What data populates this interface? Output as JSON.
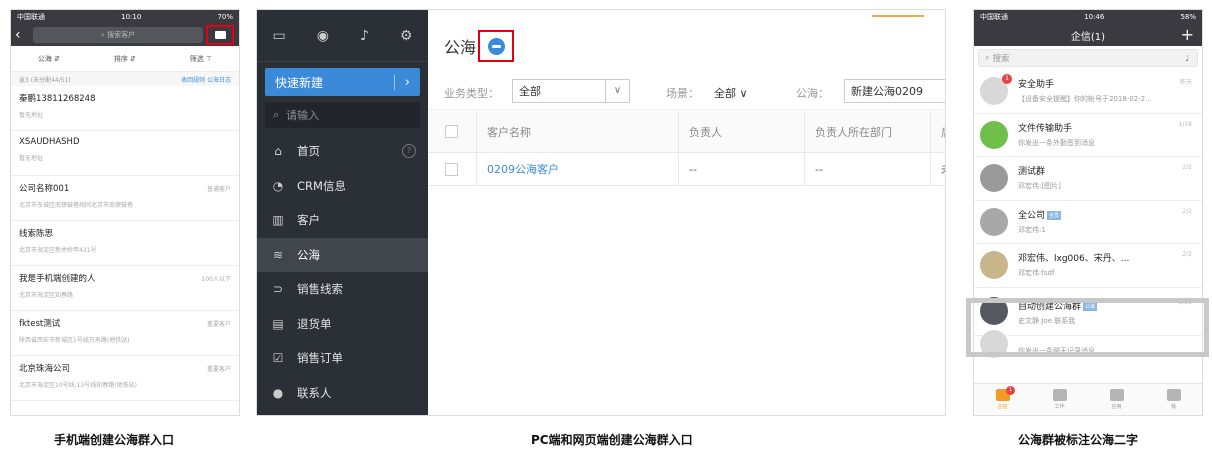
{
  "phone1": {
    "status": {
      "carrier": "中国联通",
      "time": "10:10",
      "battery": "70%"
    },
    "search_placeholder": "搜索客户",
    "filters": [
      "公海 ⇵",
      "排序 ⇵",
      "筛选 ⊤"
    ],
    "summary": "返3 (未分配44/51)",
    "summary_links": "收回规则  公海日志",
    "rows": [
      {
        "name": "秦鹏13811268248",
        "sub": "暂无地址",
        "tag": ""
      },
      {
        "name": "XSAUDHASHD",
        "sub": "暂无地址",
        "tag": ""
      },
      {
        "name": "公司名称001",
        "sub": "北京市东城区南锣鼓巷胡同北京市南锣鼓巷",
        "tag": "普通客户"
      },
      {
        "name": "线索陈思",
        "sub": "北京市海淀区新虎桥甲421号",
        "tag": ""
      },
      {
        "name": "我是手机端创建的人",
        "sub": "北京市海淀区知春路",
        "tag": "100人以下"
      },
      {
        "name": "fktest测试",
        "sub": "陕西省西安市新城区1号线万寿路(地铁站)",
        "tag": "重要客户"
      },
      {
        "name": "北京珠海公司",
        "sub": "北京市海淀区10号线;13号线知春路(地铁站)",
        "tag": "重要客户"
      }
    ]
  },
  "pc": {
    "quick_create": "快速新建",
    "search_placeholder": "请输入",
    "nav": [
      {
        "icon": "⌂",
        "label": "首页",
        "help": "?"
      },
      {
        "icon": "◔",
        "label": "CRM信息"
      },
      {
        "icon": "▥",
        "label": "客户"
      },
      {
        "icon": "≋",
        "label": "公海"
      },
      {
        "icon": "⊃",
        "label": "销售线索"
      },
      {
        "icon": "▤",
        "label": "退货单"
      },
      {
        "icon": "☑",
        "label": "销售订单"
      },
      {
        "icon": "●",
        "label": "联系人"
      }
    ],
    "page_title": "公海",
    "filters": {
      "biz_label": "业务类型：",
      "biz_value": "全部",
      "scene_label": "场景：",
      "scene_value": "全部",
      "sea_label": "公海：",
      "sea_value": "新建公海0209"
    },
    "columns": [
      "客户名称",
      "负责人",
      "负责人所在部门",
      "后"
    ],
    "row": [
      "0209公海客户",
      "--",
      "--",
      "未"
    ]
  },
  "phone2": {
    "status": {
      "carrier": "中国联通",
      "time": "10:46",
      "battery": "58%"
    },
    "title": "企信(1)",
    "search_placeholder": "搜索",
    "conversations": [
      {
        "title": "安全助手",
        "snippet": "【设备安全提醒】你的帐号于2018-02-2...",
        "time": "昨天",
        "badge": "1",
        "avatar": "#d8d8d8",
        "tag": ""
      },
      {
        "title": "文件传输助手",
        "snippet": "你发出一条外勤签到消息",
        "time": "1/18",
        "badge": "",
        "avatar": "#6fbf4a",
        "tag": ""
      },
      {
        "title": "测试群",
        "snippet": "邓宏伟:[图片]",
        "time": "2/2",
        "badge": "",
        "avatar": "#9a9a9a",
        "tag": ""
      },
      {
        "title": "全公司",
        "snippet": "邓宏伟:1",
        "time": "2/2",
        "badge": "",
        "avatar": "#a8a8a8",
        "tag": "全员"
      },
      {
        "title": "邓宏伟、lxg006、宋丹、...",
        "snippet": "邓宏伟:fsdf",
        "time": "2/2",
        "badge": "",
        "avatar": "#c9b58a",
        "tag": ""
      },
      {
        "title": "自动创建公海群",
        "snippet": "史文静:Joe 联系我",
        "time": "1/31",
        "badge": "",
        "avatar": "#555a60",
        "tag": "公海"
      },
      {
        "title": "",
        "snippet": "你发出一条聊天记录消息",
        "time": "",
        "badge": "",
        "avatar": "#d8d8d8",
        "tag": ""
      }
    ],
    "tabs": [
      {
        "label": "企信",
        "badge": "1",
        "active": true
      },
      {
        "label": "工作",
        "badge": "",
        "active": false
      },
      {
        "label": "应用",
        "badge": "",
        "active": false
      },
      {
        "label": "我",
        "badge": "",
        "active": false
      }
    ]
  },
  "captions": {
    "left": "手机端创建公海群入口",
    "middle": "PC端和网页端创建公海群入口",
    "right": "公海群被标注公海二字"
  }
}
